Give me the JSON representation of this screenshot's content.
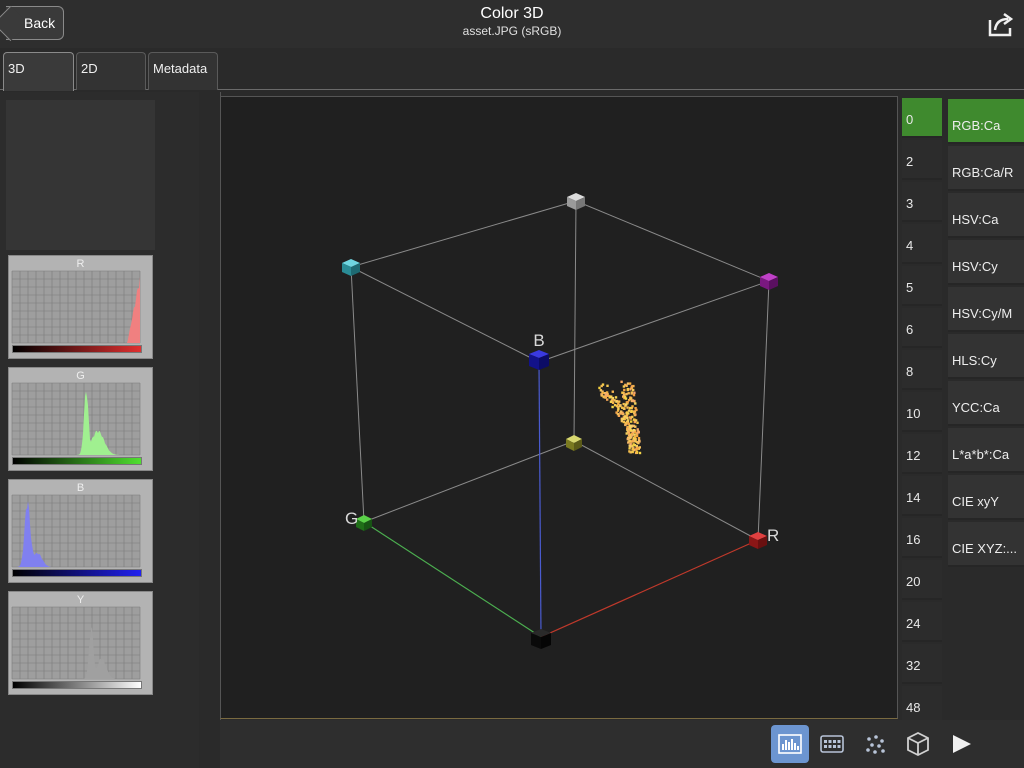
{
  "header": {
    "back_label": "Back",
    "title": "Color 3D",
    "subtitle": "asset.JPG (sRGB)"
  },
  "tabs": [
    {
      "label": "3D",
      "active": true
    },
    {
      "label": "2D",
      "active": false
    },
    {
      "label": "Metadata",
      "active": false
    }
  ],
  "histograms": [
    {
      "label": "R",
      "color": "#f08080",
      "ramp_to": "#e03030"
    },
    {
      "label": "G",
      "color": "#a0f090",
      "ramp_to": "#50e030"
    },
    {
      "label": "B",
      "color": "#8080f0",
      "ramp_to": "#2020f0"
    },
    {
      "label": "Y",
      "color": "#a0a0a0",
      "ramp_to": "#ffffff"
    }
  ],
  "cube": {
    "axis_labels": {
      "b": "B",
      "g": "G",
      "r": "R"
    },
    "colors": {
      "r_axis": "#c0392b",
      "g_axis": "#4caf50",
      "b_axis": "#4a5bd0",
      "point_cloud": "#f0a850"
    }
  },
  "levels": {
    "selected": "0",
    "items": [
      "0",
      "2",
      "3",
      "4",
      "5",
      "6",
      "8",
      "10",
      "12",
      "14",
      "16",
      "20",
      "24",
      "32",
      "48"
    ]
  },
  "modes": {
    "selected": "RGB:Ca",
    "items": [
      "RGB:Ca",
      "RGB:Ca/R",
      "HSV:Ca",
      "HSV:Cy",
      "HSV:Cy/M",
      "HLS:Cy",
      "YCC:Ca",
      "L*a*b*:Ca",
      "CIE xyY",
      "CIE XYZ:..."
    ]
  },
  "toolbar": {
    "active": "histogram-view",
    "buttons": [
      "histogram-view",
      "grid-view",
      "points-view",
      "cube-view",
      "play"
    ]
  }
}
